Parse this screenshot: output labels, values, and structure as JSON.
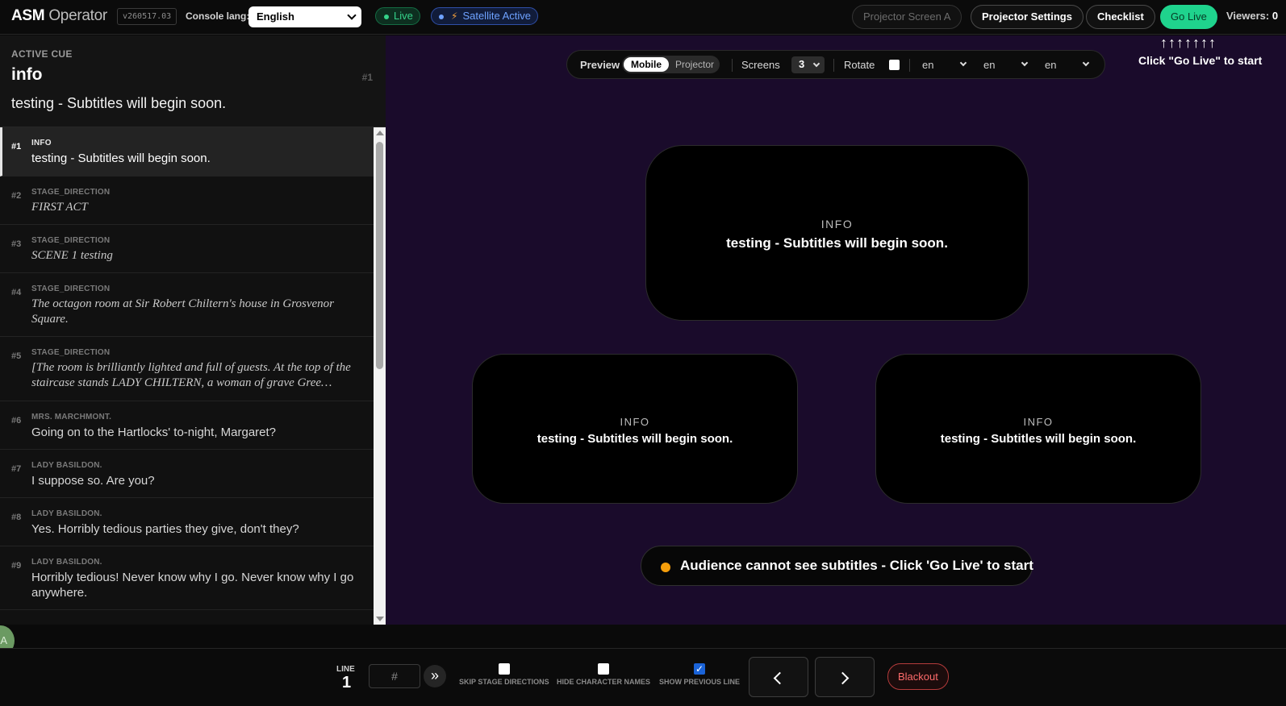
{
  "header": {
    "brand": "ASM",
    "brand_sub": "Operator",
    "version": "v260517.03",
    "console_lang_label": "Console lang:",
    "console_lang_value": "English",
    "live_badge": "Live",
    "satellite_badge": "Satellite Active",
    "projector_screen_btn": "Projector Screen A",
    "projector_settings_btn": "Projector Settings",
    "checklist_btn": "Checklist",
    "go_live_btn": "Go Live",
    "viewers_label": "Viewers:",
    "viewers_count": "0",
    "hint_arrows": "↑↑↑↑↑↑↑",
    "hint_text": "Click \"Go Live\" to start"
  },
  "active_cue": {
    "label": "ACTIVE CUE",
    "type": "info",
    "number": "#1",
    "text": "testing - Subtitles will begin soon."
  },
  "cues": [
    {
      "num": "#1",
      "type": "INFO",
      "text": "testing - Subtitles will begin soon.",
      "italic": false,
      "active": true
    },
    {
      "num": "#2",
      "type": "STAGE_DIRECTION",
      "text": "FIRST ACT",
      "italic": true
    },
    {
      "num": "#3",
      "type": "STAGE_DIRECTION",
      "text": "SCENE 1 testing",
      "italic": true
    },
    {
      "num": "#4",
      "type": "STAGE_DIRECTION",
      "text": "The octagon room at Sir Robert Chiltern's house in Grosvenor Square.",
      "italic": true
    },
    {
      "num": "#5",
      "type": "STAGE_DIRECTION",
      "text": "[The room is brilliantly lighted and full of guests. At the top of the staircase stands LADY CHILTERN, a woman of grave Gree…",
      "italic": true
    },
    {
      "num": "#6",
      "type": "MRS. MARCHMONT.",
      "text": "Going on to the Hartlocks' to-night, Margaret?",
      "italic": false
    },
    {
      "num": "#7",
      "type": "LADY BASILDON.",
      "text": "I suppose so. Are you?",
      "italic": false
    },
    {
      "num": "#8",
      "type": "LADY BASILDON.",
      "text": "Yes. Horribly tedious parties they give, don't they?",
      "italic": false
    },
    {
      "num": "#9",
      "type": "LADY BASILDON.",
      "text": "Horribly tedious! Never know why I go. Never know why I go anywhere.",
      "italic": false
    }
  ],
  "avatar_initial": "A",
  "preview": {
    "label": "Preview",
    "mode_mobile": "Mobile",
    "mode_projector": "Projector",
    "screens_label": "Screens",
    "screens_value": "3",
    "rotate_label": "Rotate",
    "lang_1": "en",
    "lang_2": "en",
    "lang_3": "en"
  },
  "screens": [
    {
      "type": "INFO",
      "text": "testing - Subtitles will begin soon."
    },
    {
      "type": "INFO",
      "text": "testing - Subtitles will begin soon."
    },
    {
      "type": "INFO",
      "text": "testing - Subtitles will begin soon."
    }
  ],
  "notice": "Audience cannot see subtitles - Click 'Go Live' to start",
  "footer": {
    "line_label": "LINE",
    "line_value": "1",
    "line_placeholder": "#",
    "jump_glyph": "»",
    "skip_stage": "SKIP STAGE DIRECTIONS",
    "hide_names": "HIDE CHARACTER NAMES",
    "show_prev": "SHOW PREVIOUS LINE",
    "show_prev_checked": true,
    "blackout": "Blackout"
  },
  "colors": {
    "accent_live": "#1fd38d",
    "stage_bg": "#1a0b2b",
    "warning": "#f59e0b",
    "danger": "#ff6b6b"
  }
}
